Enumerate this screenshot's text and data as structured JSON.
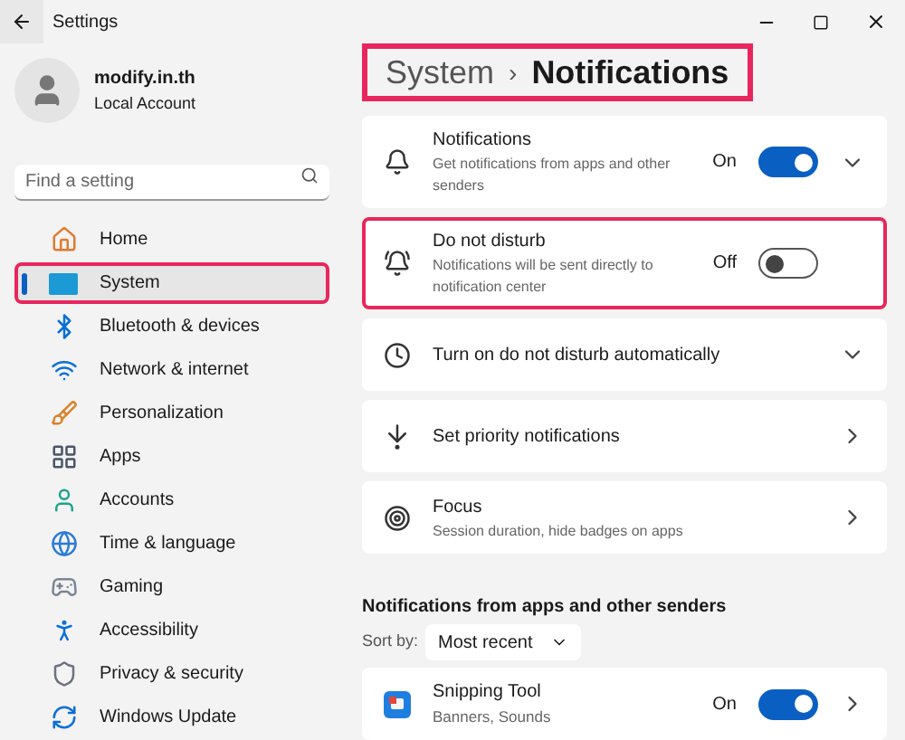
{
  "window": {
    "title": "Settings"
  },
  "profile": {
    "name": "modify.in.th",
    "account": "Local Account"
  },
  "search": {
    "placeholder": "Find a setting"
  },
  "nav": [
    {
      "kind": "home",
      "label": "Home",
      "selected": false,
      "highlighted": false
    },
    {
      "kind": "system",
      "label": "System",
      "selected": true,
      "highlighted": true
    },
    {
      "kind": "bluetooth",
      "label": "Bluetooth & devices",
      "selected": false,
      "highlighted": false
    },
    {
      "kind": "network",
      "label": "Network & internet",
      "selected": false,
      "highlighted": false
    },
    {
      "kind": "personalization",
      "label": "Personalization",
      "selected": false,
      "highlighted": false
    },
    {
      "kind": "apps",
      "label": "Apps",
      "selected": false,
      "highlighted": false
    },
    {
      "kind": "accounts",
      "label": "Accounts",
      "selected": false,
      "highlighted": false
    },
    {
      "kind": "time",
      "label": "Time & language",
      "selected": false,
      "highlighted": false
    },
    {
      "kind": "gaming",
      "label": "Gaming",
      "selected": false,
      "highlighted": false
    },
    {
      "kind": "accessibility",
      "label": "Accessibility",
      "selected": false,
      "highlighted": false
    },
    {
      "kind": "privacy",
      "label": "Privacy & security",
      "selected": false,
      "highlighted": false
    },
    {
      "kind": "update",
      "label": "Windows Update",
      "selected": false,
      "highlighted": false
    }
  ],
  "breadcrumb": {
    "parent": "System",
    "separator": "›",
    "current": "Notifications",
    "highlighted": true
  },
  "cards": [
    {
      "kind": "notifications",
      "title": "Notifications",
      "subtitle": "Get notifications from apps and other senders",
      "state_label": "On",
      "on": true,
      "highlighted": false
    },
    {
      "kind": "dnd",
      "title": "Do not disturb",
      "subtitle": "Notifications will be sent directly to notification center",
      "state_label": "Off",
      "on": false,
      "highlighted": true
    },
    {
      "kind": "schedule",
      "title": "Turn on do not disturb automatically",
      "highlighted": false
    },
    {
      "kind": "priority",
      "title": "Set priority notifications",
      "highlighted": false
    },
    {
      "kind": "focus",
      "title": "Focus",
      "subtitle": "Session duration, hide badges on apps",
      "highlighted": false
    }
  ],
  "apps_section": {
    "heading": "Notifications from apps and other senders",
    "sort_label": "Sort by:",
    "sort_value": "Most recent",
    "apps": [
      {
        "title": "Snipping Tool",
        "subtitle": "Banners, Sounds",
        "state_label": "On",
        "on": true
      }
    ]
  }
}
